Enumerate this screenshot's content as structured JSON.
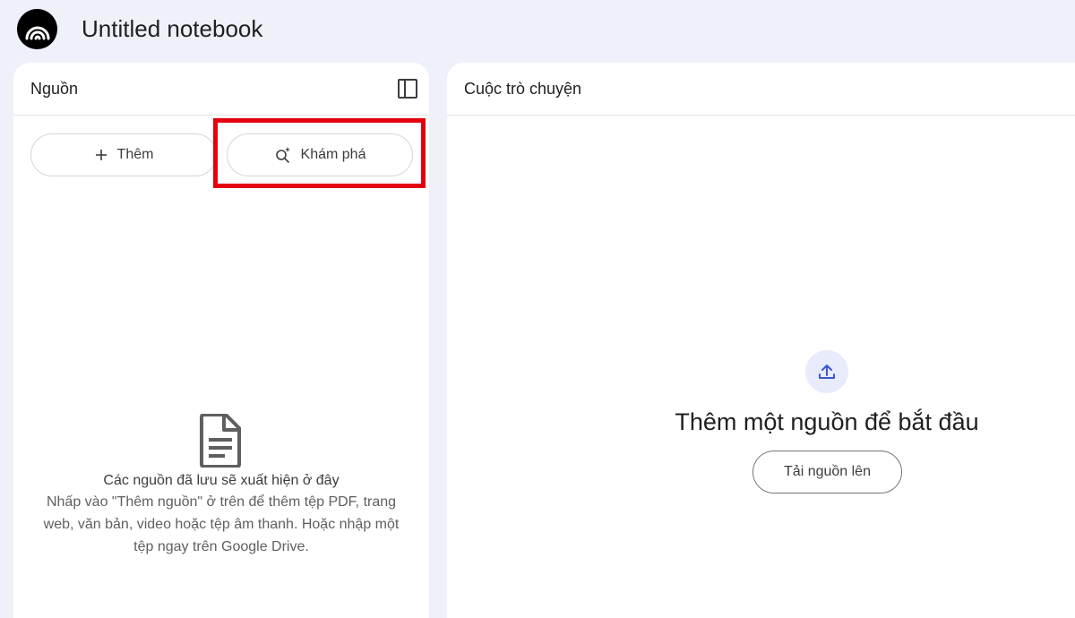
{
  "header": {
    "title": "Untitled notebook",
    "logo_icon": "notebooklm-logo"
  },
  "sources": {
    "title": "Nguồn",
    "collapse_icon": "sidebar-collapse-icon",
    "add_label": "Thêm",
    "discover_label": "Khám phá",
    "empty_title": "Các nguồn đã lưu sẽ xuất hiện ở đây",
    "empty_desc": "Nhấp vào \"Thêm nguồn\" ở trên để thêm tệp PDF, trang web, văn bản, video hoặc tệp âm thanh. Hoặc nhập một tệp ngay trên Google Drive."
  },
  "chat": {
    "title": "Cuộc trò chuyện",
    "empty_title": "Thêm một nguồn để bắt đầu",
    "upload_label": "Tải nguồn lên"
  },
  "colors": {
    "background": "#eef0fa",
    "panel": "#ffffff",
    "highlight": "#e3000f",
    "upload_circle": "#e8ebfc",
    "accent": "#3b57d9"
  }
}
